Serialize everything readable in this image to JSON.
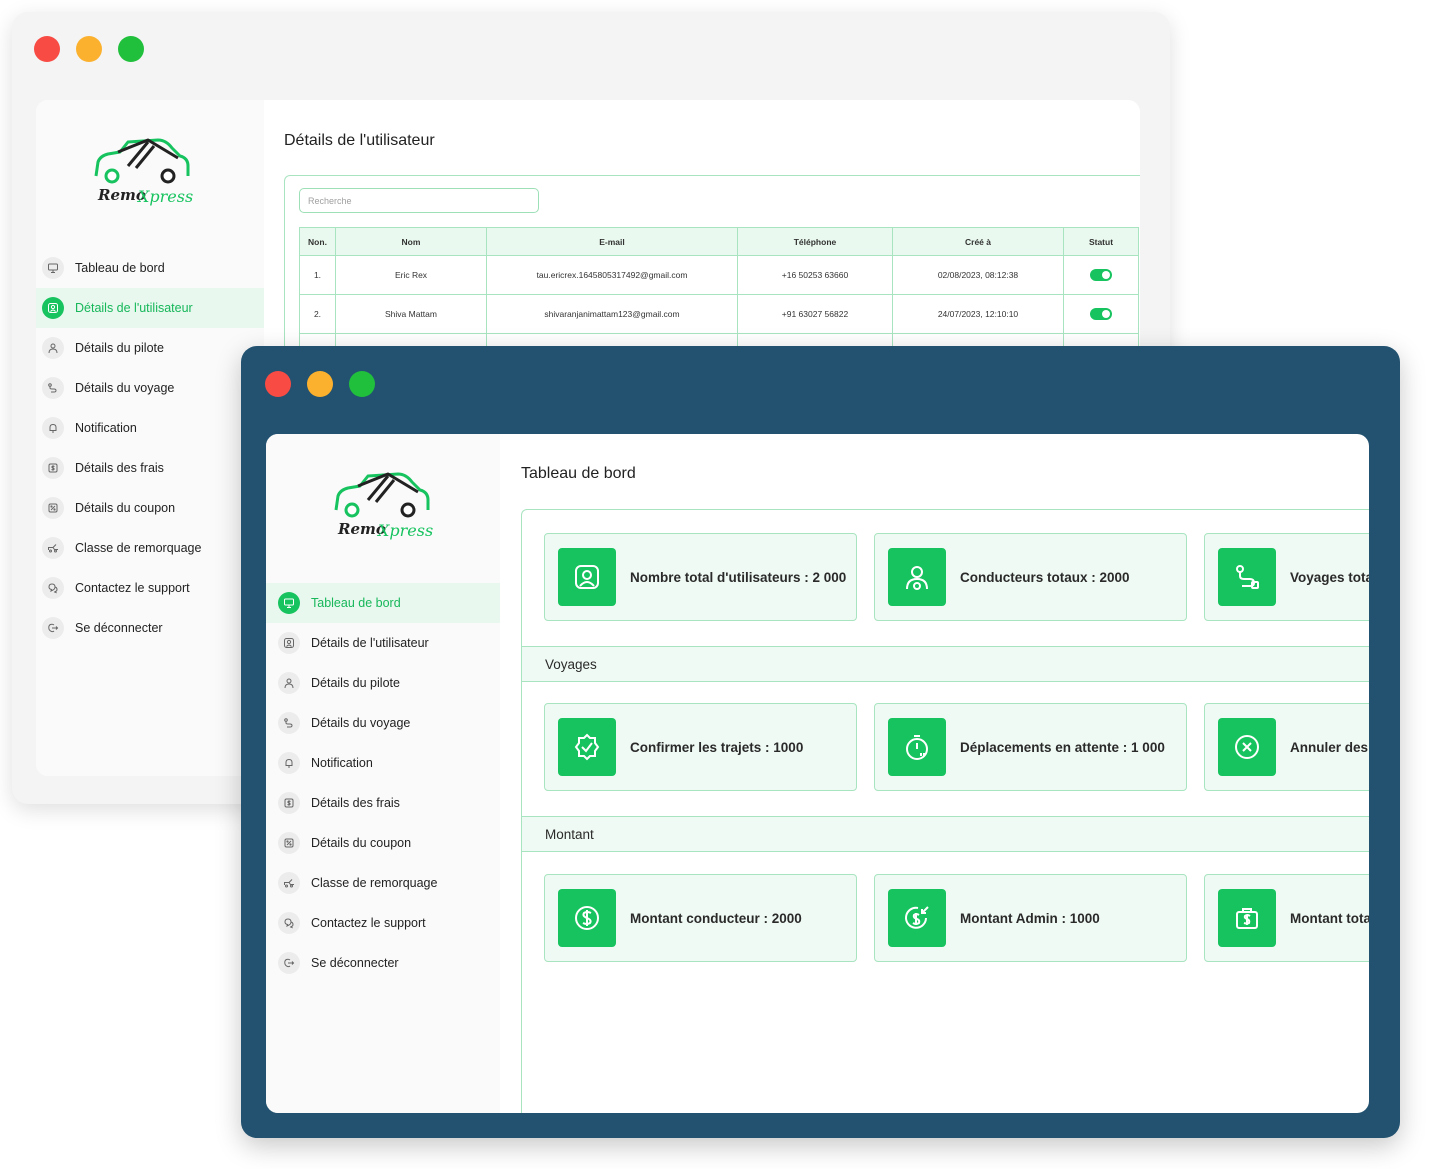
{
  "brand": {
    "name_part1": "Remo",
    "name_part2": "Xpress",
    "green": "#17c35f",
    "dark_window": "#225270"
  },
  "nav": [
    {
      "id": "dashboard",
      "label": "Tableau de bord",
      "icon": "monitor-icon"
    },
    {
      "id": "users",
      "label": "Détails de l'utilisateur",
      "icon": "user-card-icon"
    },
    {
      "id": "pilot",
      "label": "Détails du pilote",
      "icon": "driver-icon"
    },
    {
      "id": "trip",
      "label": "Détails du voyage",
      "icon": "route-icon"
    },
    {
      "id": "notification",
      "label": "Notification",
      "icon": "bell-icon"
    },
    {
      "id": "fees",
      "label": "Détails des frais",
      "icon": "dollar-icon"
    },
    {
      "id": "coupon",
      "label": "Détails du coupon",
      "icon": "coupon-icon"
    },
    {
      "id": "towing",
      "label": "Classe de remorquage",
      "icon": "tow-truck-icon"
    },
    {
      "id": "support",
      "label": "Contactez le support",
      "icon": "support-icon"
    },
    {
      "id": "logout",
      "label": "Se déconnecter",
      "icon": "logout-icon"
    }
  ],
  "back_window": {
    "title": "Détails de l'utilisateur",
    "active_nav": "users",
    "search_placeholder": "Recherche",
    "columns": [
      "Non.",
      "Nom",
      "E-mail",
      "Téléphone",
      "Créé à",
      "Statut"
    ],
    "rows": [
      {
        "no": "1.",
        "name": "Eric Rex",
        "email": "tau.ericrex.1645805317492@gmail.com",
        "phone": "+16 50253 63660",
        "created": "02/08/2023, 08:12:38",
        "status": true
      },
      {
        "no": "2.",
        "name": "Shiva Mattam",
        "email": "shivaranjanimattam123@gmail.com",
        "phone": "+91 63027 56822",
        "created": "24/07/2023, 12:10:10",
        "status": true
      }
    ]
  },
  "front_window": {
    "title": "Tableau de bord",
    "active_nav": "dashboard",
    "stats_row": [
      {
        "label": "Nombre total d'utilisateurs : 2 000",
        "icon": "user-card-icon"
      },
      {
        "label": "Conducteurs totaux : 2000",
        "icon": "driver-icon"
      },
      {
        "label": "Voyages tota",
        "icon": "route-icon"
      }
    ],
    "sections": [
      {
        "title": "Voyages",
        "cards": [
          {
            "label": "Confirmer les trajets : 1000",
            "icon": "badge-check-icon"
          },
          {
            "label": "Déplacements en attente : 1 000",
            "icon": "timer-icon"
          },
          {
            "label": "Annuler des",
            "icon": "cancel-circle-icon"
          }
        ]
      },
      {
        "title": "Montant",
        "cards": [
          {
            "label": "Montant conducteur : 2000",
            "icon": "dollar-circle-icon"
          },
          {
            "label": "Montant Admin : 1000",
            "icon": "dollar-arrow-icon"
          },
          {
            "label": "Montant tota",
            "icon": "money-bag-icon"
          }
        ]
      }
    ]
  }
}
